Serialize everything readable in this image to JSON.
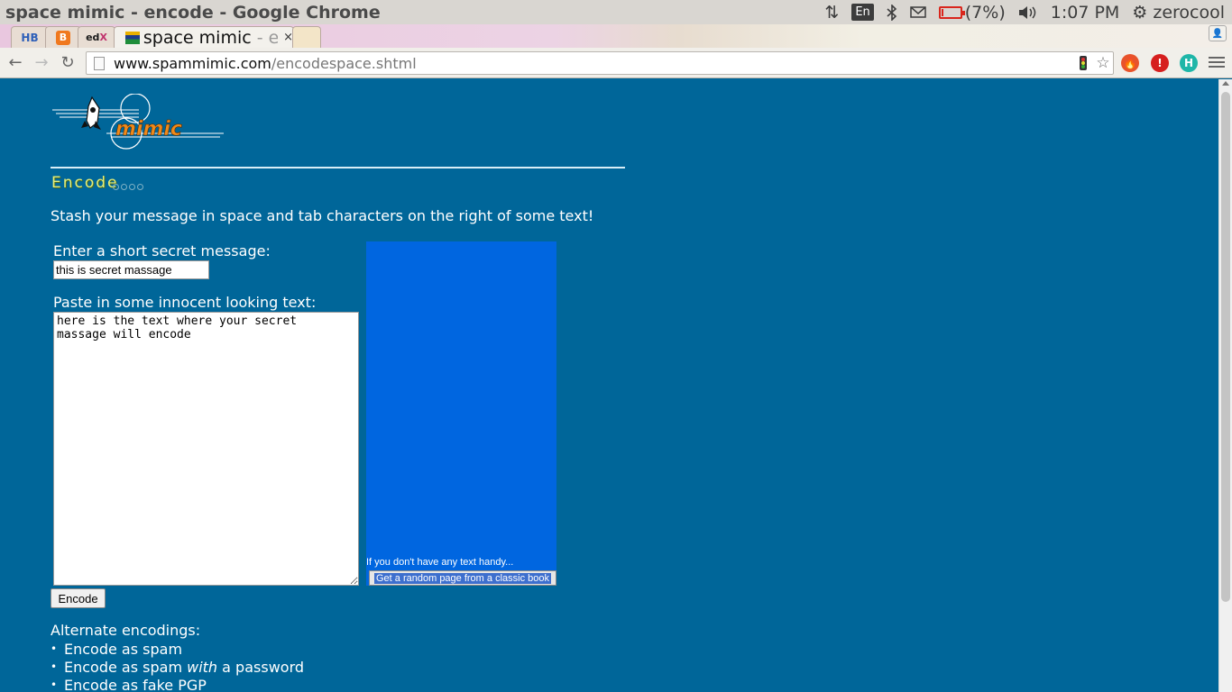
{
  "os": {
    "window_title": "space mimic - encode - Google Chrome",
    "keyboard": "En",
    "battery": "(7%)",
    "battery_level": 0.07,
    "time": "1:07 PM",
    "user": "zerocool"
  },
  "tabs": [
    {
      "favicon": "HB",
      "title": ""
    },
    {
      "favicon": "blogger-icon",
      "title": ""
    },
    {
      "favicon": "edX",
      "title": ""
    },
    {
      "favicon": "site-flag-icon",
      "title": "space mimic",
      "title_fade": " - e",
      "close": "×"
    }
  ],
  "toolbar": {
    "url_host": "www.spammimic.com",
    "url_path": "/encodespace.shtml"
  },
  "page": {
    "section_title": "Encode",
    "intro": "Stash your message in space and tab characters on the right of some text!",
    "secret_label": "Enter a short secret message:",
    "secret_value": "this is secret massage",
    "text_label": "Paste in some innocent looking text:",
    "text_value": "here is the text where your secret\nmassage will encode",
    "handy_text": "If you don't have any text handy...",
    "random_button": "Get a random page from a classic book",
    "encode_button": "Encode",
    "alt_title": "Alternate encodings:",
    "alt_links": {
      "spam": "Encode as spam",
      "spam_password_pre": "Encode as spam ",
      "spam_password_em": "with",
      "spam_password_post": " a password",
      "fake_pgp": "Encode as fake PGP"
    }
  },
  "colors": {
    "page_bg": "#006699",
    "ad_box": "#0066e0",
    "title_yellow": "#e6ef7a"
  }
}
